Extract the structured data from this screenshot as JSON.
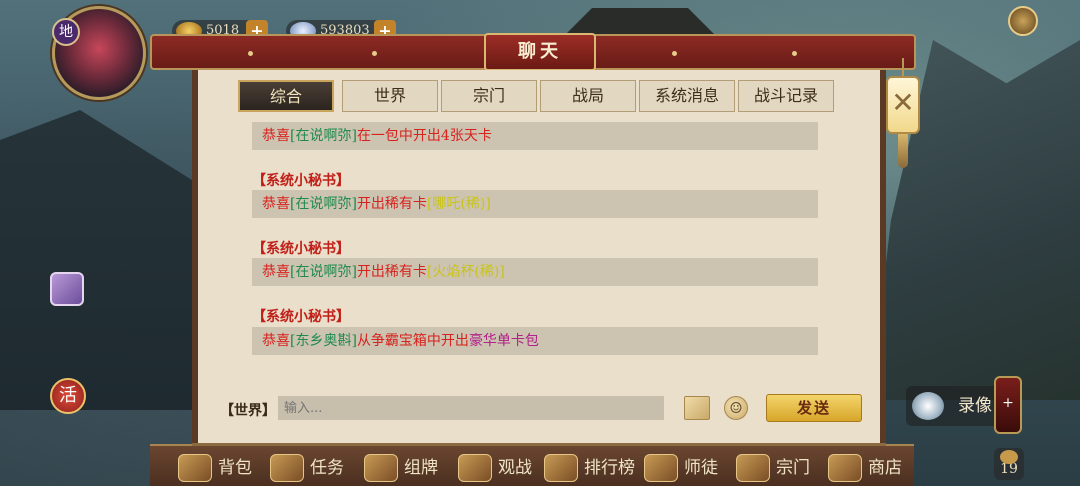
{
  "hud": {
    "currency1": "5018",
    "currency2": "593803",
    "avatar_badge": "地",
    "level": "19",
    "huo_label": "活"
  },
  "chat": {
    "title": "聊天",
    "tabs": [
      "综合",
      "世界",
      "宗门",
      "战局",
      "系统消息",
      "战斗记录"
    ],
    "active_tab": "综合",
    "messages": [
      {
        "sender": "",
        "parts": [
          {
            "text": "恭喜",
            "color": "red"
          },
          {
            "text": "[在说啊弥]",
            "color": "green"
          },
          {
            "text": "在一包中开出4张天卡",
            "color": "red"
          }
        ]
      },
      {
        "sender": "【系统小秘书】",
        "parts": [
          {
            "text": "恭喜",
            "color": "red"
          },
          {
            "text": "[在说啊弥]",
            "color": "green"
          },
          {
            "text": "开出稀有卡",
            "color": "red"
          },
          {
            "text": "[哪吒(稀)]",
            "color": "yellow"
          }
        ]
      },
      {
        "sender": "【系统小秘书】",
        "parts": [
          {
            "text": "恭喜",
            "color": "red"
          },
          {
            "text": "[在说啊弥]",
            "color": "green"
          },
          {
            "text": "开出稀有卡",
            "color": "red"
          },
          {
            "text": "[火焰杯(稀)]",
            "color": "yellow"
          }
        ]
      },
      {
        "sender": "【系统小秘书】",
        "parts": [
          {
            "text": "恭喜",
            "color": "red"
          },
          {
            "text": "[东乡奥斟]",
            "color": "green"
          },
          {
            "text": "从争霸宝箱中开出",
            "color": "red"
          },
          {
            "text": "豪华单卡包",
            "color": "purple"
          }
        ]
      }
    ],
    "channel_label": "【世界】",
    "input_placeholder": "输入...",
    "send_label": "发送"
  },
  "nav": {
    "items": [
      "背包",
      "任务",
      "组牌",
      "观战",
      "排行榜",
      "师徒",
      "宗门",
      "商店"
    ]
  },
  "record_label": "录像",
  "colors": {
    "red": "#d8221d",
    "green": "#1f8a4c",
    "yellow": "#c9c41a",
    "purple": "#b1228a",
    "header": "#8c2a23",
    "send_button": "#e8bf45"
  }
}
